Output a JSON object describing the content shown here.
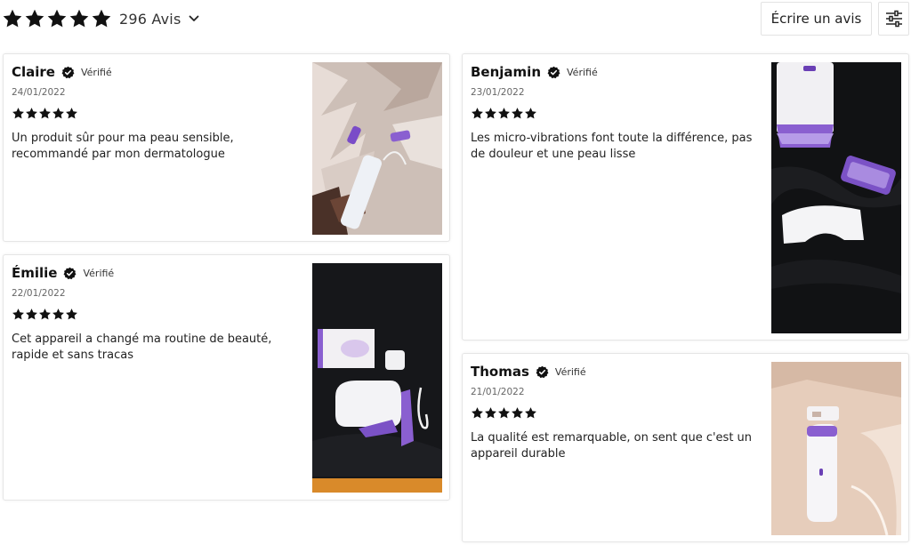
{
  "summary": {
    "rating_stars": 5,
    "count_label": "296 Avis",
    "write_review_label": "Écrire un avis",
    "filter_icon": "sliders-icon",
    "chevron_icon": "chevron-down-icon"
  },
  "reviews": [
    {
      "name": "Claire",
      "verified_label": "Vérifié",
      "date": "24/01/2022",
      "rating": 5,
      "text": "Un produit sûr pour ma peau sensible, recommandé par mon dermatologue",
      "photo": "photo of the device on a fluffy rug"
    },
    {
      "name": "Benjamin",
      "verified_label": "Vérifié",
      "date": "23/01/2022",
      "rating": 5,
      "text": "Les micro-vibrations font toute la différence, pas de douleur et une peau lisse",
      "photo": "photo of the device parts on a dark fabric"
    },
    {
      "name": "Émilie",
      "verified_label": "Vérifié",
      "date": "22/01/2022",
      "rating": 5,
      "text": "Cet appareil a changé ma routine de beauté, rapide et sans tracas",
      "photo": "photo of the device with box and cable"
    },
    {
      "name": "Thomas",
      "verified_label": "Vérifié",
      "date": "21/01/2022",
      "rating": 5,
      "text": "La qualité est remarquable, on sent que c'est un appareil durable",
      "photo": "photo of the device on a sink"
    }
  ],
  "colors": {
    "star": "#111111",
    "accent_purple": "#8a5fd0",
    "border": "#e5e5e5"
  }
}
